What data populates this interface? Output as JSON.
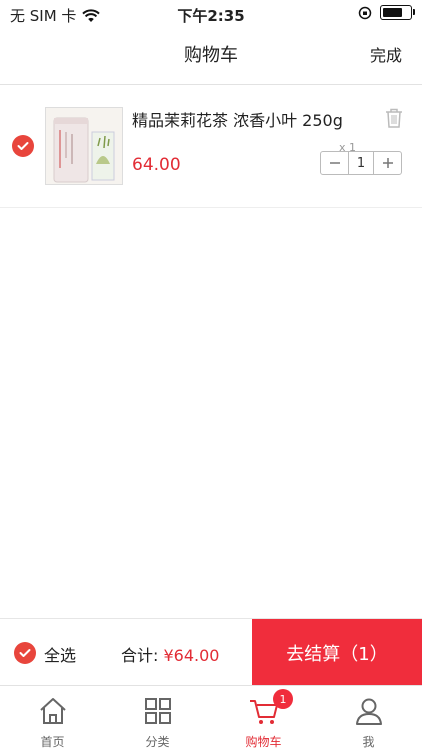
{
  "status_bar": {
    "carrier": "无 SIM 卡",
    "time": "下午2:35",
    "battery_level": 0.8
  },
  "nav": {
    "title": "购物车",
    "done": "完成"
  },
  "cart_items": [
    {
      "title": "精品茉莉花茶 浓香小叶 250g",
      "price": "64.00",
      "qty_text": "x 1",
      "qty": "1",
      "selected": true,
      "image_icon": "tea-canister-image"
    }
  ],
  "footer": {
    "select_all": "全选",
    "total_label": "合计:",
    "total_amount": "¥64.00",
    "checkout": "去结算（1）"
  },
  "tabs": [
    {
      "label": "首页",
      "icon": "home-icon"
    },
    {
      "label": "分类",
      "icon": "grid-icon"
    },
    {
      "label": "购物车",
      "icon": "cart-icon",
      "active": true,
      "badge": "1"
    },
    {
      "label": "我",
      "icon": "user-icon"
    }
  ],
  "colors": {
    "accent": "#e8453c",
    "checkout": "#f02d3c",
    "price": "#e22c35"
  }
}
